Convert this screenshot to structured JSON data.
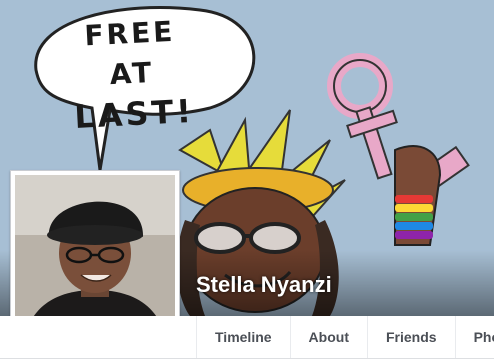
{
  "cover": {
    "speech_line1": "FREE AT",
    "speech_line2": "LAST!"
  },
  "profile": {
    "name": "Stella Nyanzi"
  },
  "tabs": [
    {
      "label": "Timeline"
    },
    {
      "label": "About"
    },
    {
      "label": "Friends"
    },
    {
      "label": "Pho"
    }
  ],
  "colors": {
    "sky": "#9fb8cf",
    "tab_text": "#4b4f56",
    "frame_border": "#c9ccd1"
  }
}
